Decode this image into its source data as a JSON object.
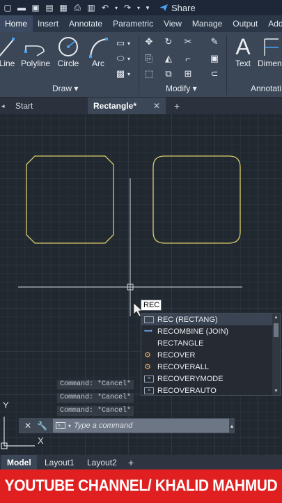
{
  "quick_access": {
    "share_label": "Share"
  },
  "ribbon_tabs": [
    "Home",
    "Insert",
    "Annotate",
    "Parametric",
    "View",
    "Manage",
    "Output",
    "Add"
  ],
  "ribbon": {
    "draw_tools": [
      "Line",
      "Polyline",
      "Circle",
      "Arc"
    ],
    "text_tool": "Text",
    "dimension_tool": "Dimen",
    "panels": {
      "draw": "Draw ▾",
      "modify": "Modify ▾",
      "annotation": "Annotati"
    }
  },
  "doc_tabs": {
    "start": "Start",
    "active": "Rectangle*"
  },
  "command_input": "REC",
  "autocomplete": [
    {
      "label": "REC (RECTANG)",
      "icon": "rectangle-icon"
    },
    {
      "label": "RECOMBINE (JOIN)",
      "icon": "join-icon"
    },
    {
      "label": "RECTANGLE",
      "icon": ""
    },
    {
      "label": "RECOVER",
      "icon": "recover-icon"
    },
    {
      "label": "RECOVERALL",
      "icon": "recoverall-icon"
    },
    {
      "label": "RECOVERYMODE",
      "icon": "recoverymode-icon"
    },
    {
      "label": "RECOVERAUTO",
      "icon": "recoverauto-icon"
    }
  ],
  "command_history": [
    "Command: *Cancel*",
    "Command: *Cancel*",
    "Command: *Cancel*"
  ],
  "command_line": {
    "placeholder": "Type a command"
  },
  "ucs": {
    "y": "Y",
    "x": "X"
  },
  "layout_tabs": [
    "Model",
    "Layout1",
    "Layout2"
  ],
  "banner_text": "YOUTUBE CHANNEL/ KHALID MAHMUD",
  "colors": {
    "canvas": "#212830",
    "geometry": "#d9cf6a",
    "banner": "#e02020"
  }
}
